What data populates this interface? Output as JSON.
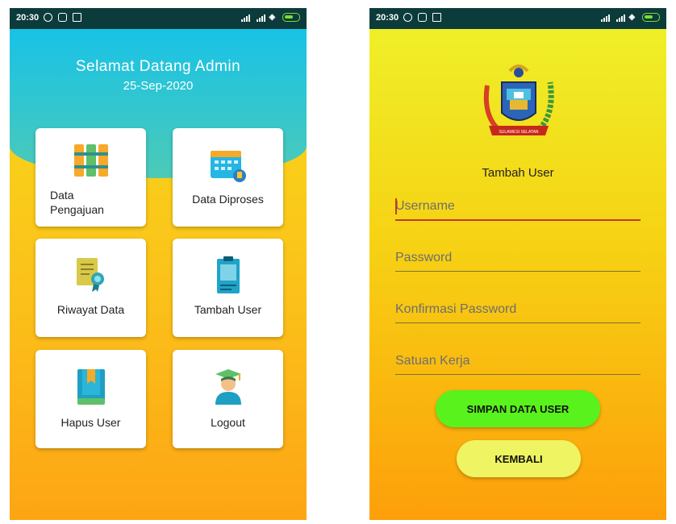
{
  "status_bar": {
    "time": "20:30"
  },
  "dashboard": {
    "welcome_title": "Selamat Datang Admin",
    "date": "25-Sep-2020",
    "menu": [
      {
        "label_line1": "Data",
        "label_line2": "Pengajuan",
        "icon": "files-icon"
      },
      {
        "label": "Data Diproses",
        "icon": "calendar-icon"
      },
      {
        "label": "Riwayat Data",
        "icon": "certificate-icon"
      },
      {
        "label": "Tambah User",
        "icon": "clipboard-icon"
      },
      {
        "label": "Hapus User",
        "icon": "book-icon"
      },
      {
        "label": "Logout",
        "icon": "graduate-icon"
      }
    ]
  },
  "add_user": {
    "title": "Tambah User",
    "logo_text": "SULAWESI SELATAN",
    "fields": {
      "username": "Username",
      "password": "Password",
      "confirm_password": "Konfirmasi Password",
      "work_unit": "Satuan Kerja"
    },
    "save_button": "SIMPAN DATA USER",
    "back_button": "KEMBALI"
  },
  "colors": {
    "status_bar": "#0c3b3b",
    "header_cyan": "#18c2e6",
    "save_button": "#5af21c",
    "back_button": "#eef462"
  }
}
